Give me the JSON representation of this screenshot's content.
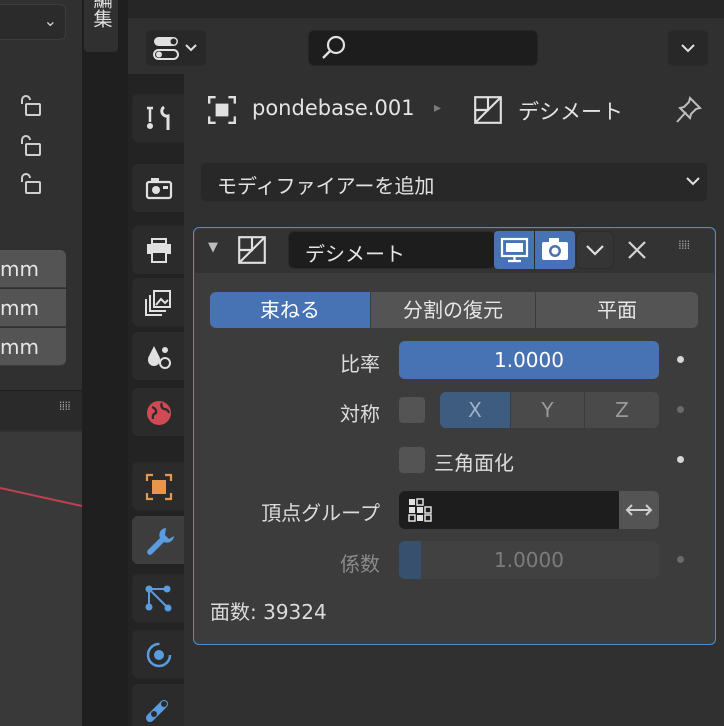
{
  "left_panel": {
    "unit_fields": [
      "mm",
      "mm",
      "mm"
    ]
  },
  "vertical_tabs": {
    "edit_tab": "編集"
  },
  "properties": {
    "breadcrumb": {
      "object_name": "pondebase.001",
      "modifier_name": "デシメート"
    },
    "add_modifier_label": "モディファイアーを追加",
    "side_tabs": [
      "tool-icon",
      "render-icon",
      "output-icon",
      "view-layer-icon",
      "scene-icon",
      "world-icon",
      "object-icon",
      "modifier-icon",
      "particles-icon",
      "physics-icon",
      "constraints-icon"
    ],
    "active_side_tab": "modifier-icon"
  },
  "modifier": {
    "name": "デシメート",
    "modes": [
      "束ねる",
      "分割の復元",
      "平面"
    ],
    "active_mode": "束ねる",
    "ratio_label": "比率",
    "ratio_value": "1.0000",
    "symmetry_label": "対称",
    "symmetry_checked": false,
    "axes": [
      "X",
      "Y",
      "Z"
    ],
    "active_axis": "X",
    "triangulate_label": "三角面化",
    "triangulate_checked": false,
    "vertex_group_label": "頂点グループ",
    "vertex_group_value": "",
    "factor_label": "係数",
    "factor_value": "1.0000",
    "face_count_text": "面数: 39324"
  },
  "colors": {
    "accent": "#4772b3",
    "panel_outline": "#4a8ed0",
    "panel_bg": "#3c3c3c"
  }
}
